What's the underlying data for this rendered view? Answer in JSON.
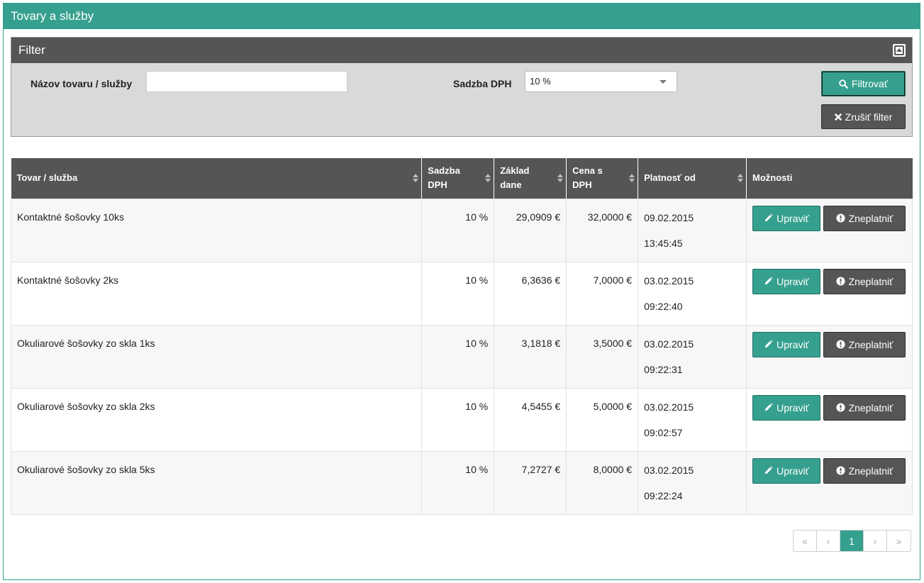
{
  "panel": {
    "title": "Tovary a služby"
  },
  "filter": {
    "title": "Filter",
    "name_label": "Názov tovaru / služby",
    "name_value": "",
    "vat_label": "Sadzba DPH",
    "vat_value": "10 %",
    "filter_button": "Filtrovať",
    "clear_button": "Zrušiť filter"
  },
  "table": {
    "headers": {
      "item": "Tovar / služba",
      "vat_rate_1": "Sadzba",
      "vat_rate_2": "DPH",
      "base_1": "Základ",
      "base_2": "dane",
      "price_1": "Cena s",
      "price_2": "DPH",
      "valid_from": "Platnosť od",
      "options": "Možnosti"
    },
    "edit_label": "Upraviť",
    "invalidate_label": "Zneplatniť",
    "rows": [
      {
        "name": "Kontaktné šošovky 10ks",
        "vat": "10 %",
        "base": "29,0909 €",
        "price": "32,0000 €",
        "date": "09.02.2015",
        "time": "13:45:45"
      },
      {
        "name": "Kontaktné šošovky 2ks",
        "vat": "10 %",
        "base": "6,3636 €",
        "price": "7,0000 €",
        "date": "03.02.2015",
        "time": "09:22:40"
      },
      {
        "name": "Okuliarové šošovky zo skla 1ks",
        "vat": "10 %",
        "base": "3,1818 €",
        "price": "3,5000 €",
        "date": "03.02.2015",
        "time": "09:22:31"
      },
      {
        "name": "Okuliarové šošovky zo skla 2ks",
        "vat": "10 %",
        "base": "4,5455 €",
        "price": "5,0000 €",
        "date": "03.02.2015",
        "time": "09:02:57"
      },
      {
        "name": "Okuliarové šošovky zo skla 5ks",
        "vat": "10 %",
        "base": "7,2727 €",
        "price": "8,0000 €",
        "date": "03.02.2015",
        "time": "09:22:24"
      }
    ]
  },
  "pagination": {
    "first": "«",
    "prev": "‹",
    "current": "1",
    "next": "›",
    "last": "»"
  },
  "colors": {
    "accent": "#36a08e",
    "dark": "#555555",
    "filter_bg": "#d9d9d9"
  }
}
